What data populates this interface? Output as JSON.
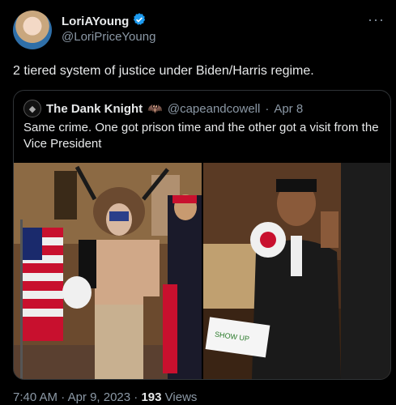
{
  "author": {
    "display_name": "LoriAYoung",
    "handle": "@LoriPriceYoung",
    "verified_icon": "verified-badge-icon"
  },
  "tweet": {
    "text": "2 tiered system of justice under Biden/Harris regime.",
    "time": "7:40 AM",
    "date": "Apr 9, 2023",
    "views_count": "193",
    "views_label": "Views"
  },
  "quoted_tweet": {
    "display_name": "The Dank Knight",
    "name_emoji": "🦇",
    "handle": "@capeandcowell",
    "date": "Apr 8",
    "text": "Same crime. One got prison time and the other got a visit from the Vice President"
  },
  "media": {
    "right_sign_text": "SHOW UP"
  },
  "colors": {
    "background": "#000000",
    "primary_text": "#e7e9ea",
    "secondary_text": "#8b98a5",
    "verified": "#1d9bf0",
    "border": "#2f3336"
  }
}
